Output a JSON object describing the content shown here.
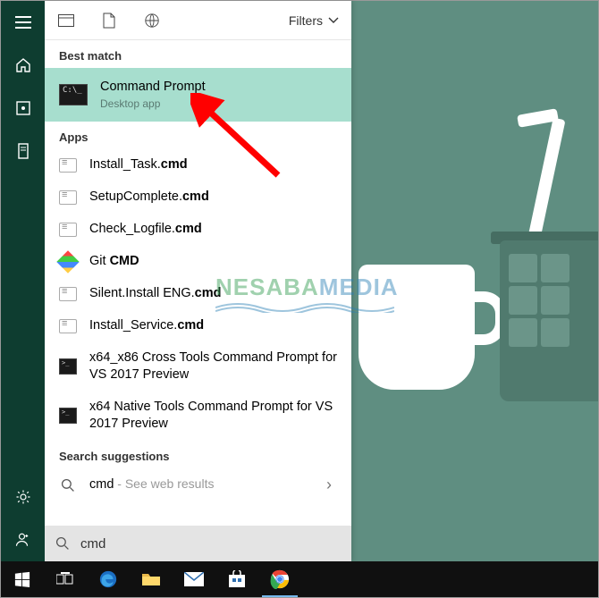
{
  "watermark": {
    "text1": "NESABA",
    "text2": "MEDIA"
  },
  "panel": {
    "filters_label": "Filters",
    "sections": {
      "best_match": "Best match",
      "apps": "Apps",
      "search_suggestions": "Search suggestions"
    }
  },
  "best_match": {
    "title": "Command Prompt",
    "subtitle": "Desktop app"
  },
  "apps": [
    {
      "pre": "Install_Task.",
      "bold": "cmd",
      "post": "",
      "icon": "cmd-file"
    },
    {
      "pre": "SetupComplete.",
      "bold": "cmd",
      "post": "",
      "icon": "cmd-file"
    },
    {
      "pre": "Check_Logfile.",
      "bold": "cmd",
      "post": "",
      "icon": "cmd-file"
    },
    {
      "pre": "Git ",
      "bold": "CMD",
      "post": "",
      "icon": "git"
    },
    {
      "pre": "Silent.Install ENG.",
      "bold": "cmd",
      "post": "",
      "icon": "cmd-file"
    },
    {
      "pre": "Install_Service.",
      "bold": "cmd",
      "post": "",
      "icon": "cmd-file"
    },
    {
      "pre": "x64_x86 Cross Tools Command Prompt for VS 2017 Preview",
      "bold": "",
      "post": "",
      "icon": "cmd-black"
    },
    {
      "pre": "x64 Native Tools Command Prompt for VS 2017 Preview",
      "bold": "",
      "post": "",
      "icon": "cmd-black"
    }
  ],
  "suggestion": {
    "term": "cmd",
    "hint": " - See web results"
  },
  "search": {
    "value": "cmd"
  }
}
